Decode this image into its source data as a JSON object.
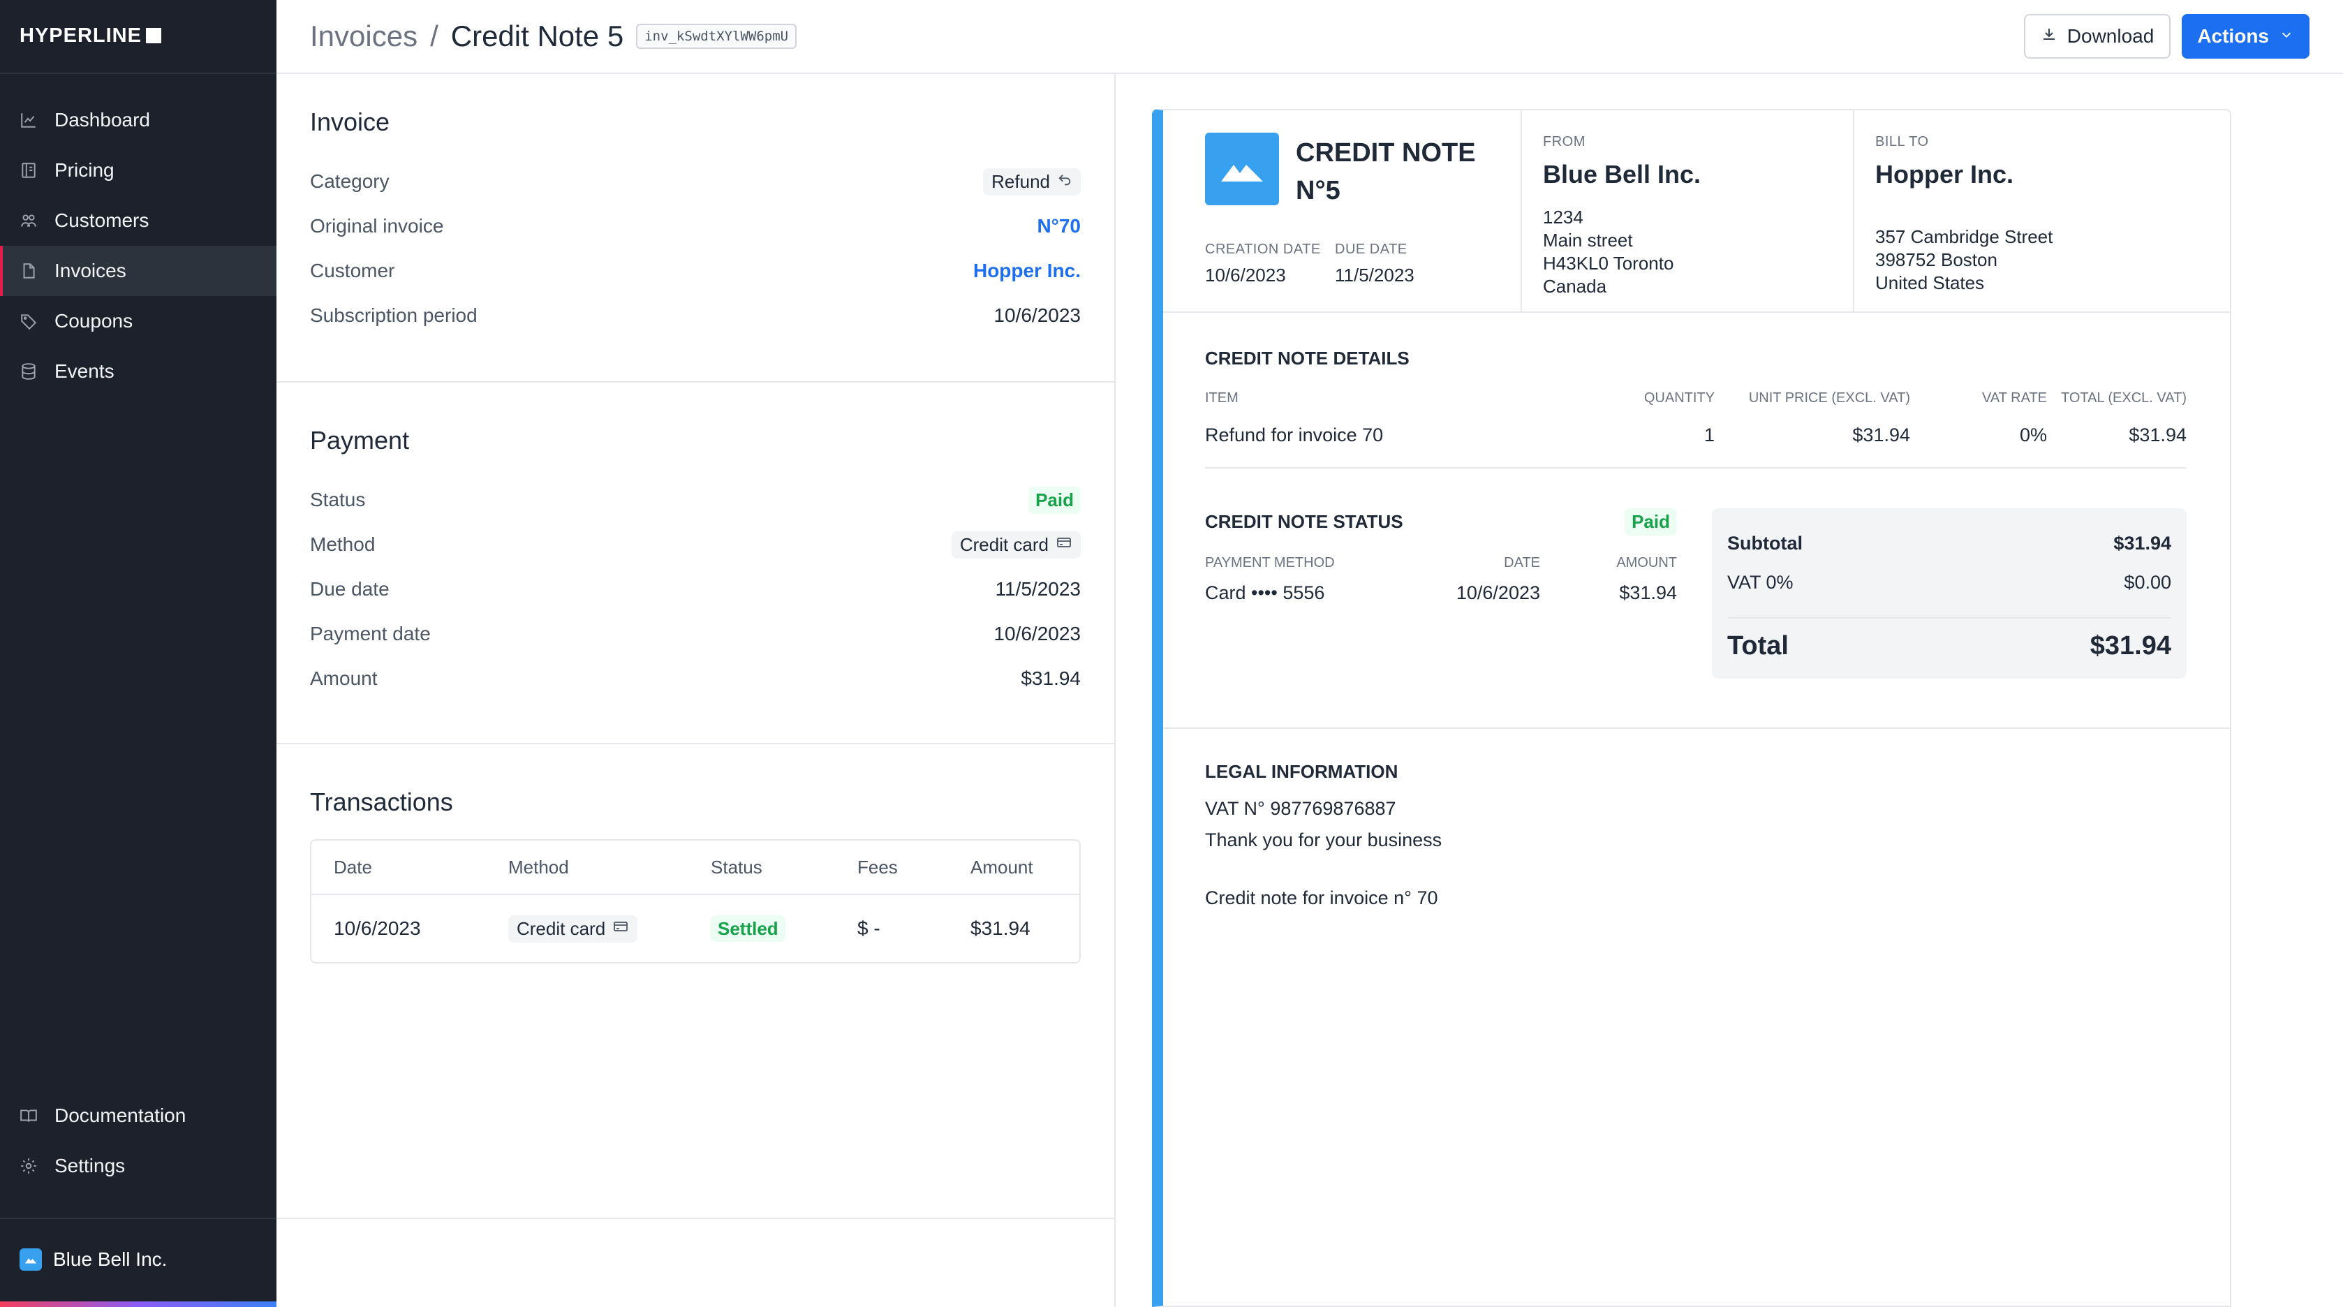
{
  "app": {
    "logo_text": "HYPERLINE"
  },
  "sidebar": {
    "items": [
      {
        "label": "Dashboard",
        "icon": "chart-line-icon"
      },
      {
        "label": "Pricing",
        "icon": "book-icon"
      },
      {
        "label": "Customers",
        "icon": "users-icon"
      },
      {
        "label": "Invoices",
        "icon": "file-icon",
        "active": true
      },
      {
        "label": "Coupons",
        "icon": "tag-icon"
      },
      {
        "label": "Events",
        "icon": "database-icon"
      }
    ],
    "bottom_items": [
      {
        "label": "Documentation",
        "icon": "open-book-icon"
      },
      {
        "label": "Settings",
        "icon": "gear-icon"
      }
    ],
    "org_name": "Blue Bell Inc."
  },
  "header": {
    "breadcrumb_parent": "Invoices",
    "separator": "/",
    "title": "Credit Note 5",
    "id_badge": "inv_kSwdtXYlWW6pmU",
    "download_label": "Download",
    "actions_label": "Actions"
  },
  "invoice": {
    "heading": "Invoice",
    "rows": [
      {
        "label": "Category",
        "value": "Refund"
      },
      {
        "label": "Original invoice",
        "value": "N°70"
      },
      {
        "label": "Customer",
        "value": "Hopper Inc."
      },
      {
        "label": "Subscription period",
        "value": "10/6/2023"
      }
    ]
  },
  "payment": {
    "heading": "Payment",
    "rows": [
      {
        "label": "Status",
        "value": "Paid"
      },
      {
        "label": "Method",
        "value": "Credit card"
      },
      {
        "label": "Due date",
        "value": "11/5/2023"
      },
      {
        "label": "Payment date",
        "value": "10/6/2023"
      },
      {
        "label": "Amount",
        "value": "$31.94"
      }
    ]
  },
  "transactions": {
    "heading": "Transactions",
    "columns": [
      "Date",
      "Method",
      "Status",
      "Fees",
      "Amount"
    ],
    "rows": [
      {
        "date": "10/6/2023",
        "method": "Credit card",
        "status": "Settled",
        "fees": "$ -",
        "amount": "$31.94"
      }
    ]
  },
  "document": {
    "title_line1": "CREDIT NOTE",
    "title_line2": "N°5",
    "creation_date_label": "CREATION DATE",
    "creation_date": "10/6/2023",
    "due_date_label": "DUE DATE",
    "due_date": "11/5/2023",
    "from_label": "FROM",
    "from_name": "Blue Bell Inc.",
    "from_address": [
      "1234",
      "Main street",
      "H43KL0 Toronto",
      "Canada"
    ],
    "bill_to_label": "BILL TO",
    "bill_to_name": "Hopper Inc.",
    "bill_to_address": [
      "357 Cambridge Street",
      "398752 Boston",
      "United States"
    ],
    "details_heading": "CREDIT NOTE DETAILS",
    "line_columns": [
      "ITEM",
      "QUANTITY",
      "UNIT PRICE (EXCL. VAT)",
      "VAT RATE",
      "TOTAL (EXCL. VAT)"
    ],
    "lines": [
      {
        "item": "Refund for invoice 70",
        "quantity": "1",
        "unit_price": "$31.94",
        "vat_rate": "0%",
        "total": "$31.94"
      }
    ],
    "status_heading": "CREDIT NOTE STATUS",
    "status_badge": "Paid",
    "payment_columns": [
      "PAYMENT METHOD",
      "DATE",
      "AMOUNT"
    ],
    "payment_row": {
      "method": "Card •••• 5556",
      "date": "10/6/2023",
      "amount": "$31.94"
    },
    "subtotal_label": "Subtotal",
    "subtotal": "$31.94",
    "vat_label": "VAT 0%",
    "vat": "$0.00",
    "total_label": "Total",
    "total": "$31.94",
    "legal_heading": "LEGAL INFORMATION",
    "legal_vat": "VAT N° 987769876887",
    "legal_thanks": "Thank you for your business",
    "legal_note": "Credit note for invoice n° 70"
  },
  "colors": {
    "sidebar_bg": "#1c212b",
    "accent_blue": "#1d6ff2",
    "brand_blue": "#38a1ef",
    "success_green": "#16a34a"
  }
}
